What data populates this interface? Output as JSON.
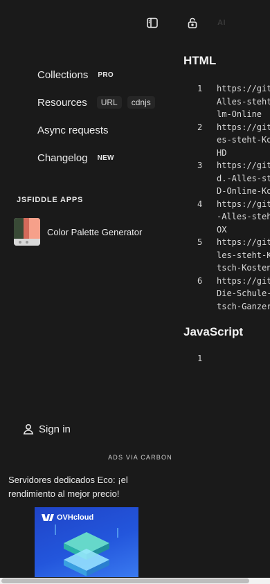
{
  "topbar": {
    "icons": [
      "sidebar-toggle-icon",
      "unlock-icon"
    ],
    "ai_label": "AI"
  },
  "nav": {
    "collections": {
      "label": "Collections",
      "badge": "PRO"
    },
    "resources": {
      "label": "Resources",
      "pills": [
        "URL",
        "cdnjs"
      ]
    },
    "async": {
      "label": "Async requests"
    },
    "changelog": {
      "label": "Changelog",
      "badge": "NEW"
    }
  },
  "apps": {
    "heading": "JSFIDDLE APPS",
    "items": [
      {
        "name": "Color Palette Generator",
        "colors": [
          "#394a36",
          "#d46a5a",
          "#f6a08a"
        ]
      }
    ]
  },
  "sign_in": {
    "label": "Sign in"
  },
  "ads": {
    "label": "ADS VIA CARBON",
    "text": "Servidores dedicados Eco: ¡el rendimiento al mejor precio!",
    "brand": "OVHcloud"
  },
  "html_panel": {
    "title": "HTML",
    "lines": [
      {
        "no": "1",
        "text": [
          "https://git",
          "Alles-steht",
          "lm-Online"
        ]
      },
      {
        "no": "2",
        "text": [
          "https://git",
          "es-steht-Ko",
          "HD"
        ]
      },
      {
        "no": "3",
        "text": [
          "https://git",
          "d.-Alles-st",
          "D-Online-Ko"
        ]
      },
      {
        "no": "4",
        "text": [
          "https://git",
          "-Alles-steh",
          "OX"
        ]
      },
      {
        "no": "5",
        "text": [
          "https://git",
          "les-steht-K",
          "tsch-Kosten"
        ]
      },
      {
        "no": "6",
        "text": [
          "https://git",
          "Die-Schule-",
          "tsch-Ganzer"
        ]
      }
    ]
  },
  "js_panel": {
    "title": "JavaScript",
    "lines": [
      {
        "no": "1",
        "text": [
          ""
        ]
      }
    ]
  },
  "colors": {
    "background": "#1a1a1a",
    "ad_blue": "#2356dc"
  }
}
